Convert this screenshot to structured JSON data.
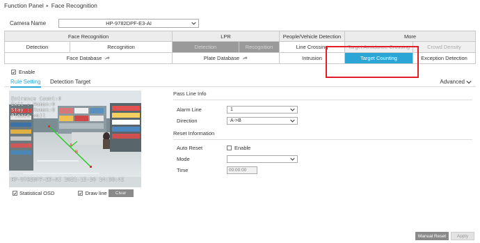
{
  "breadcrumb": {
    "parent": "Function Panel",
    "separator": "▸",
    "current": "Face Recognition"
  },
  "camera": {
    "label": "Camera Name",
    "value": "HP-9782DPF-E3-AI"
  },
  "tabs": {
    "row1": [
      "Face Recognition",
      "LPR",
      "People/Vehicle Detection",
      "More"
    ],
    "row2": [
      "Detection",
      "Recognition",
      "Detection",
      "Recognition",
      "Line Crossing",
      "Target Avoidance Crossing",
      "Crowd Density"
    ],
    "row3": [
      "Face Database",
      "Plate Database",
      "Intrusion",
      "Target Counting",
      "Exception Detection"
    ]
  },
  "enable": {
    "label": "Enable",
    "checked": true
  },
  "subtabs": {
    "rule_setting": "Rule Setting",
    "detection_target": "Detection Target",
    "advanced": "Advanced"
  },
  "video": {
    "osd_lines": [
      "Entrance Count:0",
      "Exit : Human:0",
      "Stay : Human:0",
      "Please wait"
    ],
    "timestamp": "HP-9782DPF-E3-AI   2021-12-20 14:30:42"
  },
  "video_controls": {
    "statistical_osd": "Statistical OSD",
    "draw_line": "Draw line",
    "clear": "Clear"
  },
  "pass_line": {
    "title": "Pass Line Info",
    "alarm_line_label": "Alarm Line",
    "alarm_line_value": "1",
    "direction_label": "Direction",
    "direction_value": "A->B"
  },
  "reset": {
    "title": "Reset Information",
    "auto_reset_label": "Auto Reset",
    "auto_reset_option": "Enable",
    "mode_label": "Mode",
    "mode_value": "",
    "time_label": "Time",
    "time_value": "00:00:00"
  },
  "actions": {
    "manual_reset": "Manual Reset",
    "apply": "Apply"
  },
  "colors": {
    "accent": "#2aa5d6",
    "highlight": "#e21d26",
    "line": "#22cc22"
  }
}
